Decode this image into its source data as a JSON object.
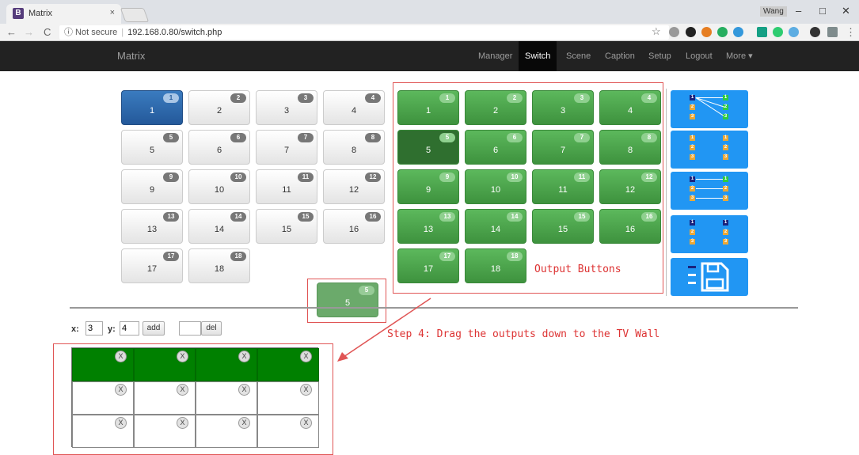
{
  "browser": {
    "tab_title": "Matrix",
    "tab_favicon": "B",
    "tab_close": "×",
    "user": "Wang",
    "min": "–",
    "restore": "□",
    "close": "✕",
    "back": "←",
    "forward": "→",
    "reload": "C",
    "secure_label": "ⓘ Not secure",
    "url": "192.168.0.80/switch.php",
    "star": "☆",
    "menu": "⋮"
  },
  "navbar": {
    "brand": "Matrix",
    "items": [
      "Manager",
      "Switch",
      "Scene",
      "Caption",
      "Setup",
      "Logout",
      "More ▾"
    ],
    "active": "Switch"
  },
  "inputs": [
    "1",
    "2",
    "3",
    "4",
    "5",
    "6",
    "7",
    "8",
    "9",
    "10",
    "11",
    "12",
    "13",
    "14",
    "15",
    "16",
    "17",
    "18"
  ],
  "input_selected": "1",
  "outputs": [
    "1",
    "2",
    "3",
    "4",
    "5",
    "6",
    "7",
    "8",
    "9",
    "10",
    "11",
    "12",
    "13",
    "14",
    "15",
    "16",
    "17",
    "18"
  ],
  "output_dragging": "5",
  "drag_ghost": {
    "label": "5",
    "badge": "5"
  },
  "annotations": {
    "output_buttons": "Output Buttons",
    "step4": "Step 4: Drag the outputs down to the TV Wall"
  },
  "mode_icons": [
    {
      "name": "one-to-many-icon"
    },
    {
      "name": "unlinked-icon"
    },
    {
      "name": "one-to-one-icon"
    },
    {
      "name": "disconnect-icon"
    },
    {
      "name": "save-icon"
    }
  ],
  "wall_controls": {
    "x_label": "x:",
    "x_value": "3",
    "y_label": "y:",
    "y_value": "4",
    "add_label": "add",
    "del_value": "",
    "del_label": "del"
  },
  "tv_wall": {
    "rows": 3,
    "cols": 4,
    "close_glyph": "X",
    "active_row": 0
  },
  "colors": {
    "input_selected": "#24599a",
    "output": "#4cae4c",
    "wall_active": "#008000",
    "mode_panel": "#2196f3",
    "annotation": "#d33333"
  }
}
